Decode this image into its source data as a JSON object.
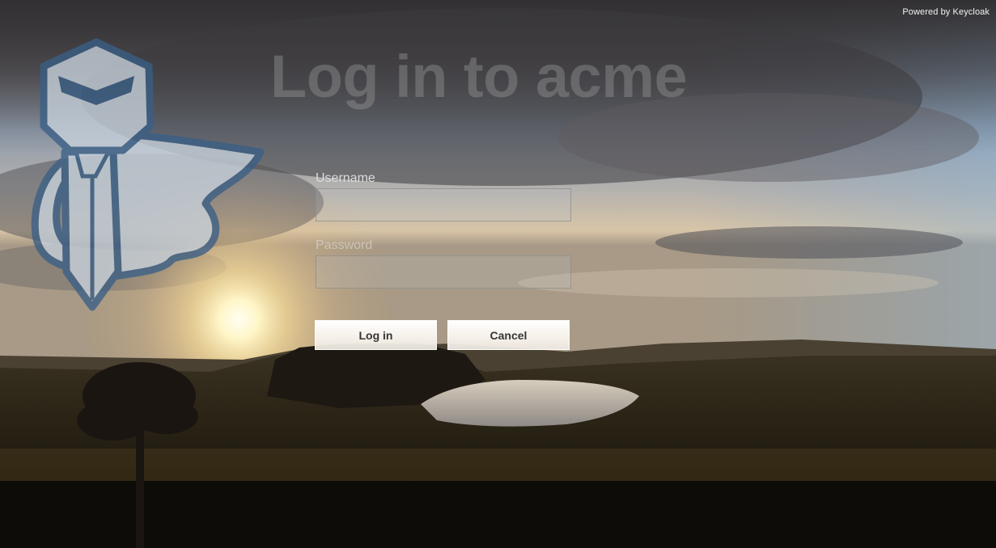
{
  "powered_by": "Powered by Keycloak",
  "title": "Log in to acme",
  "form": {
    "username_label": "Username",
    "username_value": "",
    "password_label": "Password",
    "password_value": ""
  },
  "buttons": {
    "login_label": "Log in",
    "cancel_label": "Cancel"
  },
  "colors": {
    "title_text": "#a0a0a0",
    "logo_blue": "#3a5f86",
    "logo_fill": "#c9d3dd",
    "button_text": "#363636"
  },
  "icons": {
    "logo": "keycloak-knight-logo"
  }
}
